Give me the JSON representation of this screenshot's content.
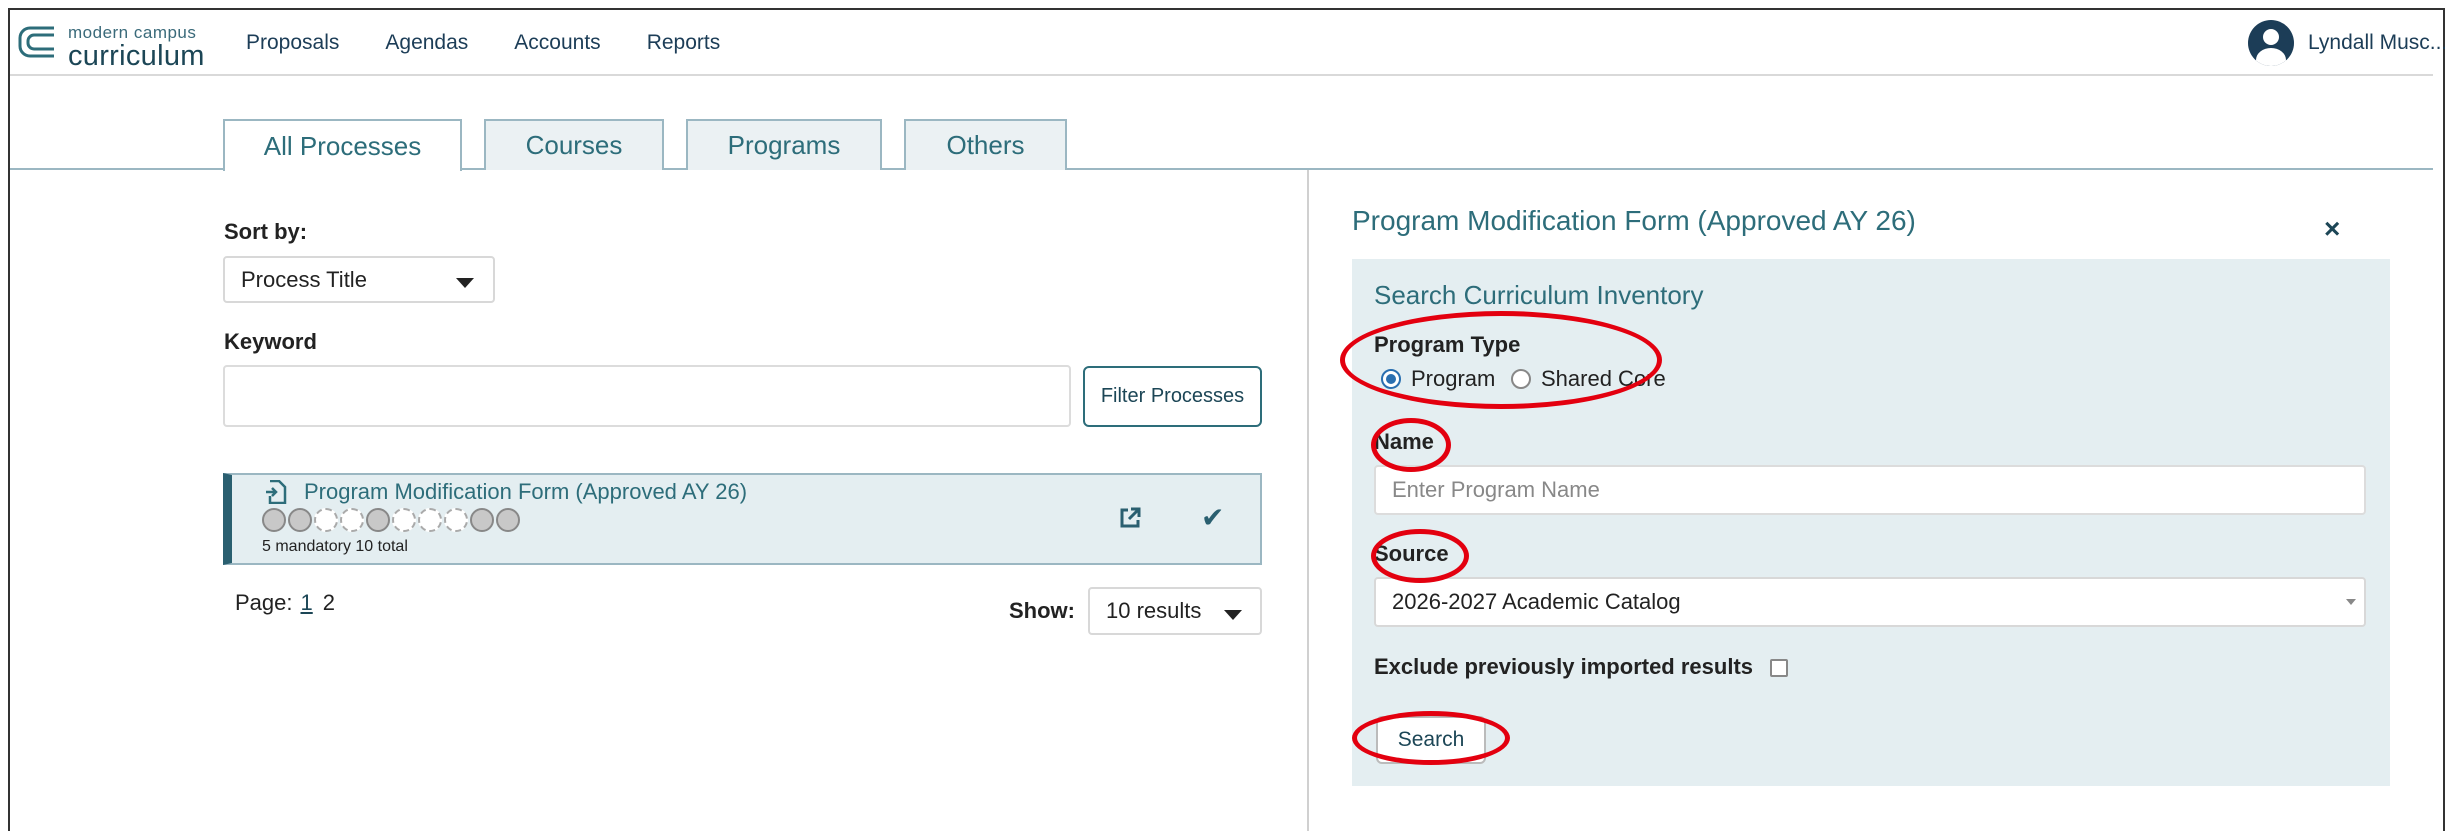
{
  "brand": {
    "line1": "modern campus",
    "line2": "curriculum",
    "tm": "™"
  },
  "nav": {
    "items": [
      "Proposals",
      "Agendas",
      "Accounts",
      "Reports"
    ],
    "user_name": "Lyndall Musc..."
  },
  "tabs": [
    "All Processes",
    "Courses",
    "Programs",
    "Others"
  ],
  "left": {
    "sort_label": "Sort by:",
    "sort_value": "Process Title",
    "keyword_label": "Keyword",
    "keyword_value": "",
    "filter_button": "Filter Processes",
    "process": {
      "title": "Program Modification Form (Approved AY 26)",
      "meta": "5 mandatory 10 total",
      "steps": [
        "filled",
        "filled",
        "empty",
        "empty",
        "filled",
        "empty",
        "empty",
        "empty",
        "filled",
        "filled"
      ]
    },
    "pager": {
      "label": "Page:",
      "current": "1",
      "next": "2"
    },
    "show_label": "Show:",
    "show_value": "10 results"
  },
  "right": {
    "title": "Program Modification Form (Approved AY 26)",
    "close": "×",
    "heading": "Search Curriculum Inventory",
    "program_type_label": "Program Type",
    "radio_program": "Program",
    "radio_shared": "Shared Core",
    "name_label": "Name",
    "name_placeholder": "Enter Program Name",
    "source_label": "Source",
    "source_value": "2026-2027 Academic Catalog",
    "exclude_label": "Exclude previously imported results",
    "search_button": "Search"
  },
  "colors": {
    "accent": "#2d6d7a",
    "nav_text": "#1c3d57",
    "panel_bg": "#e4eef1",
    "annotation": "#e3000f"
  }
}
